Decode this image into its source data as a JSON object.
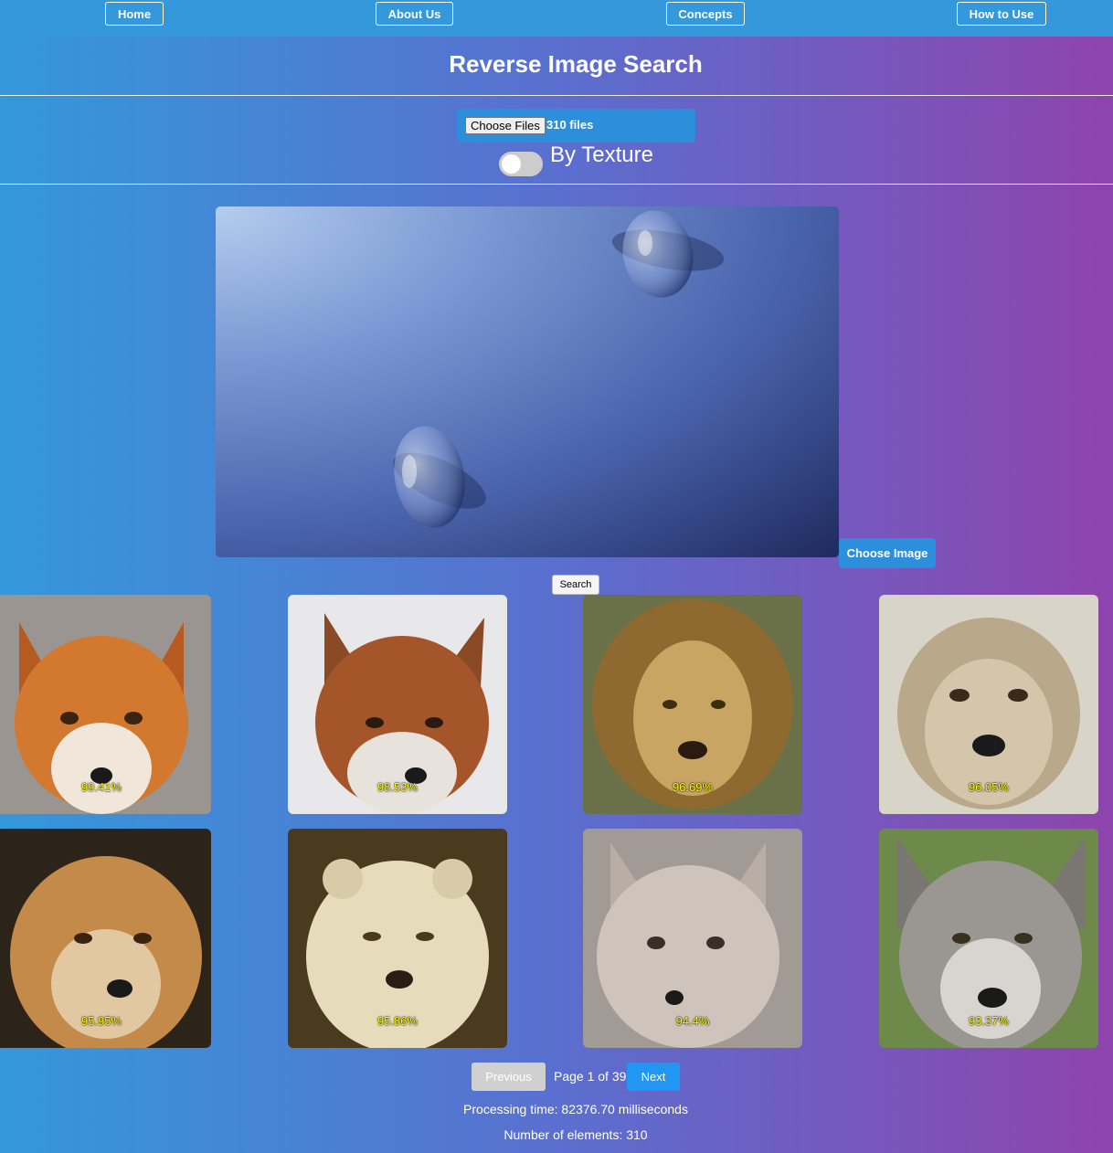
{
  "nav": {
    "items": [
      {
        "label": "Home"
      },
      {
        "label": "About Us"
      },
      {
        "label": "Concepts"
      },
      {
        "label": "How to Use"
      }
    ]
  },
  "header": {
    "title": "Reverse Image Search"
  },
  "upload": {
    "button_label": "Choose Files",
    "status": "310 files"
  },
  "toggle": {
    "label": "By Texture",
    "checked": false
  },
  "preview": {
    "alt": "water drops on blue surface"
  },
  "actions": {
    "choose_image_label": "Choose Image",
    "search_label": "Search"
  },
  "results": [
    {
      "score": "99.41%",
      "animal": "fox"
    },
    {
      "score": "98.53%",
      "animal": "fox"
    },
    {
      "score": "96.69%",
      "animal": "lion"
    },
    {
      "score": "96.05%",
      "animal": "cheetah"
    },
    {
      "score": "95.95%",
      "animal": "cheetah"
    },
    {
      "score": "95.86%",
      "animal": "lioness"
    },
    {
      "score": "94.4%",
      "animal": "fox"
    },
    {
      "score": "93.37%",
      "animal": "wolf"
    }
  ],
  "pagination": {
    "previous_label": "Previous",
    "page_info": "Page 1 of 39",
    "next_label": "Next"
  },
  "stats": {
    "processing_time": "Processing time: 82376.70 milliseconds",
    "element_count": "Number of elements: 310"
  }
}
